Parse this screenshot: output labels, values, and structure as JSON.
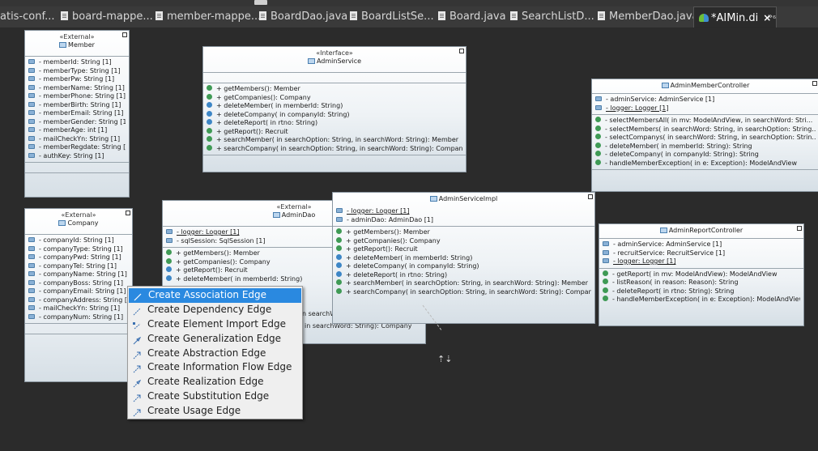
{
  "tabs": [
    {
      "label": "atis-conf...",
      "icon": "none"
    },
    {
      "label": "board-mappe...",
      "icon": "file-icon"
    },
    {
      "label": "member-mappe...",
      "icon": "file-icon"
    },
    {
      "label": "BoardDao.java",
      "icon": "file-icon"
    },
    {
      "label": "BoardListSe...",
      "icon": "file-icon"
    },
    {
      "label": "Board.java",
      "icon": "file-icon"
    },
    {
      "label": "SearchListD...",
      "icon": "file-icon"
    },
    {
      "label": "MemberDao.java",
      "icon": "file-icon"
    },
    {
      "label": "*AIMin.di",
      "icon": "diagram-icon",
      "active": true
    }
  ],
  "tab_overflow": "»₆",
  "tab_close": "×",
  "classes": {
    "member": {
      "stereotype": "«External»",
      "name": "Member",
      "attributes": [
        "- memberId: String [1]",
        "- memberType: String [1]",
        "- memberPw: String [1]",
        "- memberName: String [1]",
        "- memberPhone: String [1]",
        "- memberBirth: String [1]",
        "- memberEmail: String [1]",
        "- memberGender: String [1]",
        "- memberAge: int [1]",
        "- mailCheckYn: String [1]",
        "- memberRegdate: String [1]",
        "- authKey: String [1]"
      ]
    },
    "admin_service": {
      "stereotype": "«Interface»",
      "name": "AdminService",
      "operations": [
        "+ getMembers(): Member",
        "+ getCompanies(): Company",
        "+ deleteMember(  in memberId: String)",
        "+ deleteCompany(  in companyId: String)",
        "+ deleteReport(  in rtno: String)",
        "+ getReport(): Recruit",
        "+ searchMember(  in searchOption: String,   in searchWord: String): Member",
        "+ searchCompany(  in searchOption: String,   in searchWord: String): Company"
      ]
    },
    "admin_member_controller": {
      "name": "AdminMemberController",
      "attributes": [
        "- adminService: AdminService [1]",
        "- logger: Logger [1]"
      ],
      "operations": [
        "- selectMembersAll(  in mv: ModelAndView,   in searchWord: Stri...",
        "- selectMembers(  in searchWord: String,   in searchOption: String...",
        "- selectCompanys(  in searchWord: String,   in searchOption: Strin...",
        "- deleteMember(  in memberId: String): String",
        "- deleteCompany(  in companyId: String): String",
        "- handleMemberException(  in e: Exception): ModelAndView"
      ]
    },
    "company": {
      "stereotype": "«External»",
      "name": "Company",
      "attributes": [
        "- companyId: String [1]",
        "- companyType: String [1]",
        "- companyPwd: String [1]",
        "- companyTel: String [1]",
        "- companyName: String [1]",
        "- companyBoss: String [1]",
        "- companyEmail: String [1]",
        "- companyAddress: String [1]",
        "- mailCheckYn: String [1]",
        "- companyNum: String [1]"
      ]
    },
    "admin_dao": {
      "stereotype": "«External»",
      "name": "AdminDao",
      "attributes": [
        "- logger: Logger [1]",
        "- sqlSession: SqlSession [1]"
      ],
      "operations": [
        "+ getMembers(): Member",
        "+ getCompanies(): Company",
        "+ getReport(): Recruit",
        "+ deleteMember(  in memberId: String)"
      ],
      "hidden_fragments": [
        "n searchW",
        "in searchWord: String): Company"
      ]
    },
    "admin_service_impl": {
      "name": "AdminServiceImpl",
      "attributes": [
        "- logger: Logger [1]",
        "- adminDao: AdminDao [1]"
      ],
      "operations": [
        "+ getMembers(): Member",
        "+ getCompanies(): Company",
        "+ getReport(): Recruit",
        "+ deleteMember(  in memberId: String)",
        "+ deleteCompany(  in companyId: String)",
        "+ deleteReport(  in rtno: String)",
        "+ searchMember(  in searchOption: String,   in searchWord: String): Member",
        "+ searchCompany(  in searchOption: String,   in searchWord: String): Company"
      ]
    },
    "admin_report_controller": {
      "name": "AdminReportController",
      "attributes": [
        "- adminService: AdminService [1]",
        "- recruitService: RecruitService [1]",
        "- logger: Logger [1]"
      ],
      "operations": [
        "- getReport(  in mv: ModelAndView): ModelAndView",
        "- listReason(  in reason: Reason): String",
        "- deleteReport(  in rtno: String): String",
        "- handleMemberException(  in e: Exception): ModelAndView"
      ]
    }
  },
  "context_menu": {
    "items": [
      {
        "label": "Create Association Edge",
        "icon": "association-edge-icon",
        "highlighted": true
      },
      {
        "label": "Create Dependency Edge",
        "icon": "dependency-edge-icon"
      },
      {
        "label": "Create Element Import Edge",
        "icon": "element-import-edge-icon"
      },
      {
        "label": "Create Generalization Edge",
        "icon": "generalization-edge-icon"
      },
      {
        "label": "Create Abstraction Edge",
        "icon": "abstraction-edge-icon"
      },
      {
        "label": "Create Information Flow Edge",
        "icon": "information-flow-edge-icon"
      },
      {
        "label": "Create Realization Edge",
        "icon": "realization-edge-icon"
      },
      {
        "label": "Create Substitution Edge",
        "icon": "substitution-edge-icon"
      },
      {
        "label": "Create Usage Edge",
        "icon": "usage-edge-icon"
      }
    ]
  },
  "colors": {
    "highlight": "#2a89e0",
    "background": "#2b2b2b",
    "menu": "#efefef"
  }
}
